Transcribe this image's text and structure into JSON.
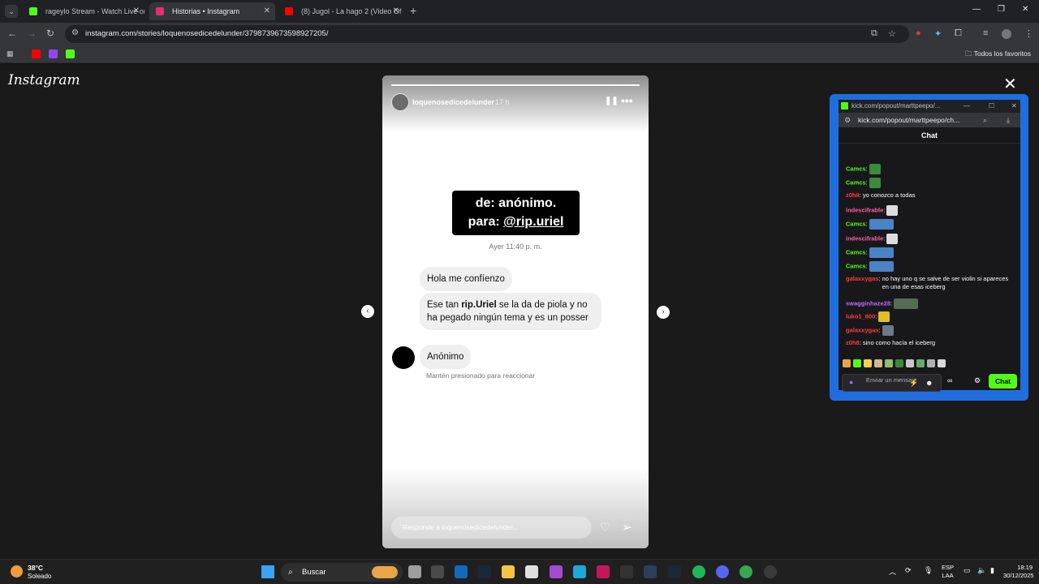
{
  "browser": {
    "tabs": [
      {
        "title": "rageylo Stream - Watch Live on",
        "favicon_color": "#53fc18",
        "active": false
      },
      {
        "title": "Historias • Instagram",
        "favicon_color": "#e1306c",
        "active": true
      },
      {
        "title": "(8) Jugol - La hago 2 (Video Of",
        "favicon_color": "#ff0000",
        "active": false
      }
    ],
    "url": "instagram.com/stories/loquenosedicedelunder/3798739673598927205/",
    "bookmarks_folder": "Todos los favoritos"
  },
  "instagram": {
    "logo": "Instagram",
    "story": {
      "username": "loquenosedicedelunder",
      "time_ago": "17 h",
      "progress": 1.0,
      "headline_line1": "de: anónimo.",
      "headline_line2_prefix": "para: ",
      "headline_handle": "@rip.uriel",
      "message_time": "Ayer 11:40 p. m.",
      "message_1": "Hola me confíenzo",
      "message_2_pre": "Ese tan ",
      "message_2_bold": "rip.Uriel",
      "message_2_post": " se la da de piola y no ha pegado ningún tema y es un posser",
      "message_3": "Anónimo",
      "hint": "Mantén presionado para reaccionar",
      "reply_placeholder": "Responde a loquenosedicedelunder..."
    }
  },
  "kick_popout": {
    "window_title": "kick.com/popout/marttpeepo/...",
    "url": "kick.com/popout/marttpeepo/ch...",
    "chat_header": "Chat",
    "messages": [
      {
        "user": "Camcs",
        "user_color": "#53fc18",
        "text": "",
        "emote_color": "#3c8a3c"
      },
      {
        "user": "Camcs",
        "user_color": "#53fc18",
        "text": "",
        "emote_color": "#3c8a3c"
      },
      {
        "user": "z0h8",
        "user_color": "#ff3b3b",
        "text": "yo conozco a todas",
        "emote_color": ""
      },
      {
        "user": "indescifrable",
        "user_color": "#ff5fa2",
        "text": "",
        "emote_color": "#dddddd"
      },
      {
        "user": "Camcs",
        "user_color": "#53fc18",
        "text": "",
        "emote_color": "#4a84c4"
      },
      {
        "user": "indescifrable",
        "user_color": "#ff5fa2",
        "text": "",
        "emote_color": "#dddddd"
      },
      {
        "user": "Camcs",
        "user_color": "#53fc18",
        "text": "",
        "emote_color": "#4a84c4"
      },
      {
        "user": "Camcs",
        "user_color": "#53fc18",
        "text": "",
        "emote_color": "#4a84c4"
      },
      {
        "user": "galaxxygas",
        "user_color": "#ff3b3b",
        "text": "no hay uno q se salve de ser violin si apareces en una de esas iceberg",
        "emote_color": ""
      },
      {
        "user": "swagginhaze28",
        "user_color": "#c06cff",
        "text": "",
        "emote_color": "#556b55"
      },
      {
        "user": "luko1_800",
        "user_color": "#ff3b3b",
        "text": "",
        "emote_color": "#e0c020"
      },
      {
        "user": "galaxxygas",
        "user_color": "#ff3b3b",
        "text": "",
        "emote_color": "#6a7a8a"
      },
      {
        "user": "z0h8",
        "user_color": "#ff3b3b",
        "text": "sino como hacía el iceberg",
        "emote_color": ""
      }
    ],
    "input_placeholder": "Enviar un mensaje",
    "send_label": "Chat"
  },
  "taskbar": {
    "weather_temp": "38°C",
    "weather_desc": "Soleado",
    "search_label": "Buscar",
    "lang_line1": "ESP",
    "lang_line2": "LAA",
    "time": "18:19",
    "date": "30/12/2025"
  }
}
